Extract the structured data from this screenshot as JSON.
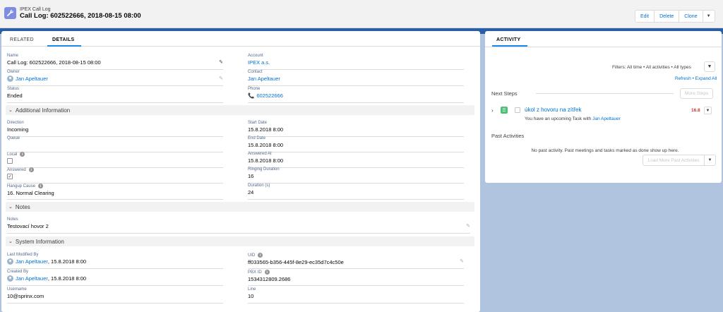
{
  "header": {
    "object_type": "IPEX Call Log",
    "title": "Call Log: 602522666, 2018-08-15 08:00",
    "buttons": {
      "edit": "Edit",
      "delete": "Delete",
      "clone": "Clone"
    }
  },
  "tabs": {
    "related": "RELATED",
    "details": "DETAILS"
  },
  "fields": {
    "name": {
      "label": "Name",
      "value": "Call Log: 602522666, 2018-08-15 08:00"
    },
    "account": {
      "label": "Account",
      "value": "IPEX a.s."
    },
    "owner": {
      "label": "Owner",
      "value": "Jan Apeltauer"
    },
    "contact": {
      "label": "Contact",
      "value": "Jan Apeltauer"
    },
    "status": {
      "label": "Status",
      "value": "Ended"
    },
    "phone": {
      "label": "Phone",
      "value": "602522666"
    }
  },
  "additional": {
    "title": "Additional Information",
    "direction": {
      "label": "Direction",
      "value": "Incoming"
    },
    "start_date": {
      "label": "Start Date",
      "value": "15.8.2018 8:00"
    },
    "queue": {
      "label": "Queue",
      "value": ""
    },
    "end_date": {
      "label": "End Date",
      "value": "15.8.2018 8:00"
    },
    "local": {
      "label": "Local",
      "checked": false
    },
    "answered_at": {
      "label": "Answered At",
      "value": "15.8.2018 8:00"
    },
    "answered": {
      "label": "Answered",
      "checked": true
    },
    "ringing_duration": {
      "label": "Ringing Duration",
      "value": "16"
    },
    "hangup_cause": {
      "label": "Hangup Cause",
      "value": "16. Normal Clearing"
    },
    "duration": {
      "label": "Duration (s)",
      "value": "24"
    }
  },
  "notes_section": {
    "title": "Notes",
    "notes": {
      "label": "Notes",
      "value": "Testovací hovor 2"
    }
  },
  "system": {
    "title": "System Information",
    "last_modified_by": {
      "label": "Last Modified By",
      "user": "Jan Apeltauer",
      "date": ", 15.8.2018 8:00"
    },
    "uid": {
      "label": "UID",
      "value": "ff033565-b356-445f-8e29-ec35d7c4c50e"
    },
    "created_by": {
      "label": "Created By",
      "user": "Jan Apeltauer",
      "date": ", 15.8.2018 8:00"
    },
    "pbx_id": {
      "label": "PBX ID",
      "value": "1534312809.2686"
    },
    "username": {
      "label": "Username",
      "value": "10@sprinx.com"
    },
    "line": {
      "label": "Line",
      "value": "10"
    }
  },
  "activity": {
    "tab": "ACTIVITY",
    "filters": "Filters: All time • All activities • All types",
    "refresh": "Refresh",
    "expand_all": "Expand All",
    "next_steps": "Next Steps",
    "more_steps": "More Steps",
    "task": {
      "title": "úkol z hovoru na zítřek",
      "date": "16.8",
      "subtitle": "You have an upcoming Task with ",
      "with_user": "Jan Apeltauer"
    },
    "past_activities": "Past Activities",
    "no_past": "No past activity. Past meetings and tasks marked as done show up here.",
    "load_more": "Load More Past Activities"
  }
}
